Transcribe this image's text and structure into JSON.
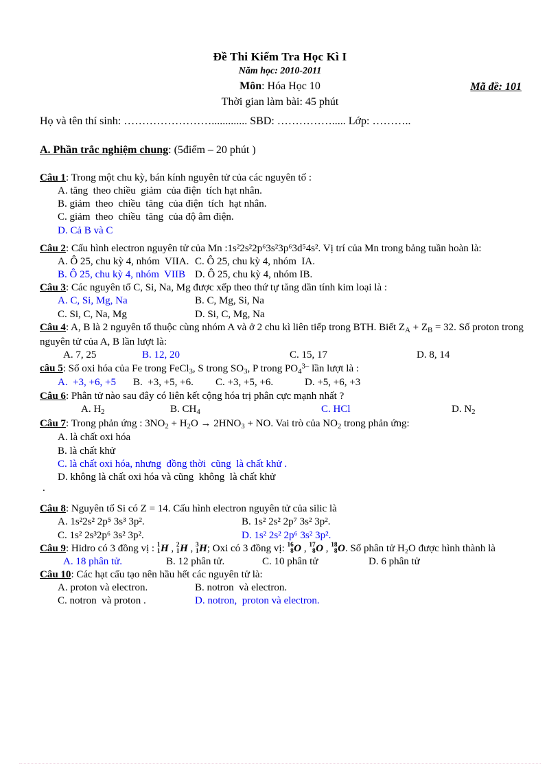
{
  "header": {
    "title": "Đề Thi Kiểm Tra Học Kì I",
    "school_year": "Năm học: 2010-2011",
    "subject_label": "Môn",
    "subject_value": ": Hóa Học 10",
    "exam_code": "Mã đề: 101",
    "duration": "Thời gian làm bài: 45 phút"
  },
  "candidate": {
    "line": "Họ và tên thí sinh: ……………………............. SBD: ……………..... Lớp: ……….."
  },
  "section": {
    "title": "A. Phần trắc nghiệm chung",
    "meta": ": (5điểm – 20 phút )"
  },
  "answer_color": "#0000ee",
  "questions": [
    {
      "label": "Câu 1",
      "stem": ": Trong một chu kỳ, bán kính nguyên  tử của các nguyên  tố :",
      "options": [
        {
          "text": "A. tăng  theo chiều  giảm  của điện  tích hạt nhân.",
          "correct": false
        },
        {
          "text": "B. giảm  theo  chiều  tăng  của điện  tích  hạt nhân.",
          "correct": false
        },
        {
          "text": "C. giảm  theo  chiều  tăng  của độ âm điện.",
          "correct": false
        },
        {
          "text": "D. Cả B và C",
          "correct": true
        }
      ]
    },
    {
      "label": "Câu 2",
      "stem_html": ": Cấu hình  electron  nguyên  tử của Mn :1s²2s²2p⁶3s²3p⁶3d⁵4s². Vị trí  của Mn trong  bảng  tuần  hoàn là:",
      "option_rows": [
        {
          "left": "A. Ô 25, chu kỳ 4, nhóm  VIIA.",
          "left_correct": false,
          "right": "C. Ô 25, chu kỳ 4, nhóm  IA.",
          "right_correct": false
        },
        {
          "left": "B. Ô 25, chu kỳ 4, nhóm  VIIB",
          "left_correct": true,
          "right": "D. Ô 25, chu kỳ 4, nhóm IB.",
          "right_correct": false
        }
      ]
    },
    {
      "label": "Câu 3",
      "stem": ": Các nguyên  tố C, Si, Na, Mg được xếp theo  thứ tự tăng  dần tính  kim loại là :",
      "option_rows": [
        {
          "left": "A. C, Si, Mg, Na",
          "left_correct": true,
          "right": "B. C, Mg, Si, Na",
          "right_correct": false
        },
        {
          "left": "C. Si, C, Na, Mg",
          "left_correct": false,
          "right": "D. Si, C, Mg, Na",
          "right_correct": false
        }
      ]
    },
    {
      "label": "Câu 4",
      "stem_html": ": A, B là 2 nguyên  tố thuộc  cùng  nhóm  A và ở 2 chu kì liên  tiếp  trong BTH. Biết  Z<sub>A</sub> + Z<sub>B</sub> = 32. Số proton trong nguyên  tử của A, B lần lượt là:",
      "options_inline": [
        {
          "text": "A. 7, 25",
          "correct": false
        },
        {
          "text": "B. 12, 20",
          "correct": true
        },
        {
          "text": "C. 15, 17",
          "correct": false
        },
        {
          "text": "D. 8, 14",
          "correct": false
        }
      ]
    },
    {
      "label": "câu 5",
      "stem_html": ": Số oxi hóa của  Fe trong FeCl<sub>3</sub>, S trong  SO<sub>3</sub>, P trong  PO<sub>4</sub><sup>3–</sup> lần lượt là :",
      "options_inline": [
        {
          "text": "A.  +3, +6, +5",
          "correct": true
        },
        {
          "text": "B.  +3, +5, +6.",
          "correct": false
        },
        {
          "text": "C. +3, +5, +6.",
          "correct": false
        },
        {
          "text": "D. +5, +6, +3",
          "correct": false
        }
      ]
    },
    {
      "label": "Câu 6",
      "stem": ": Phân tử nào sau đây có liên  kết cộng hóa trị phân cực mạnh  nhất ?",
      "options_inline_html": [
        {
          "html": "A. H<sub>2</sub>",
          "correct": false
        },
        {
          "html": "B. CH<sub>4</sub>",
          "correct": false
        },
        {
          "html": "C. HCl",
          "correct": true
        },
        {
          "html": "D. N<sub>2</sub>",
          "correct": false
        }
      ]
    },
    {
      "label": "Câu 7",
      "stem_html": ": Trong phản ứng : 3NO<sub>2</sub>  +  H<sub>2</sub>O  →  2HNO<sub>3</sub>  + NO. Vai trò của NO<sub>2</sub> trong phản ứng:",
      "options": [
        {
          "text": "A. là chất oxi hóa",
          "correct": false
        },
        {
          "text": "B. là chất khử",
          "correct": false
        },
        {
          "text": "C. là chất oxi hóa, nhưng  đồng thời  cũng  là chất khử .",
          "correct": true
        },
        {
          "text": "D. không là chất oxi hóa và cũng  không  là chất khử",
          "correct": false
        }
      ]
    },
    {
      "label": "Câu 8",
      "stem": ": Nguyên  tố Si có Z = 14. Cấu hình  electron  nguyên  tử của silic  là",
      "option_rows_html": [
        {
          "left": "A. 1s²2s² 2p⁵ 3s³ 3p².",
          "left_correct": false,
          "right": "B. 1s² 2s² 2p⁷ 3s² 3p².",
          "right_correct": false
        },
        {
          "left": "C. 1s² 2s³2p⁶ 3s² 3p².",
          "left_correct": false,
          "right": "D. 1s² 2s² 2p⁶ 3s² 3p².",
          "right_correct": true
        }
      ]
    },
    {
      "label": "Câu 9",
      "stem_prefix": ": Hidro  có 3 đồng vị : ",
      "isotopes_h": [
        {
          "mass": "1",
          "atomic": "1",
          "symbol": "H"
        },
        {
          "mass": "2",
          "atomic": "1",
          "symbol": "H"
        },
        {
          "mass": "3",
          "atomic": "1",
          "symbol": "H"
        }
      ],
      "stem_middle": "; Oxi có 3 đồng vị:  ",
      "isotopes_o": [
        {
          "mass": "16",
          "atomic": "8",
          "symbol": "O"
        },
        {
          "mass": "17",
          "atomic": "8",
          "symbol": "O"
        },
        {
          "mass": "18",
          "atomic": "8",
          "symbol": "O"
        }
      ],
      "stem_suffix": ". Số phân tử H₂O được hình thành  là",
      "options_inline": [
        {
          "text": "A. 18 phân tử.",
          "correct": true
        },
        {
          "text": "B. 12 phân tử.",
          "correct": false
        },
        {
          "text": "C. 10 phân tử",
          "correct": false
        },
        {
          "text": "D. 6 phân tử",
          "correct": false
        }
      ]
    },
    {
      "label": "Câu 10",
      "stem": ": Các hạt cấu tạo nên hầu hết các nguyên  tử là:",
      "option_rows": [
        {
          "left": "A. proton và electron.",
          "left_correct": false,
          "right": "B. notron  và electron.",
          "right_correct": false
        },
        {
          "left": "C. notron  và proton .",
          "left_correct": false,
          "right": "D. notron,  proton và electron.",
          "right_correct": true
        }
      ]
    }
  ]
}
